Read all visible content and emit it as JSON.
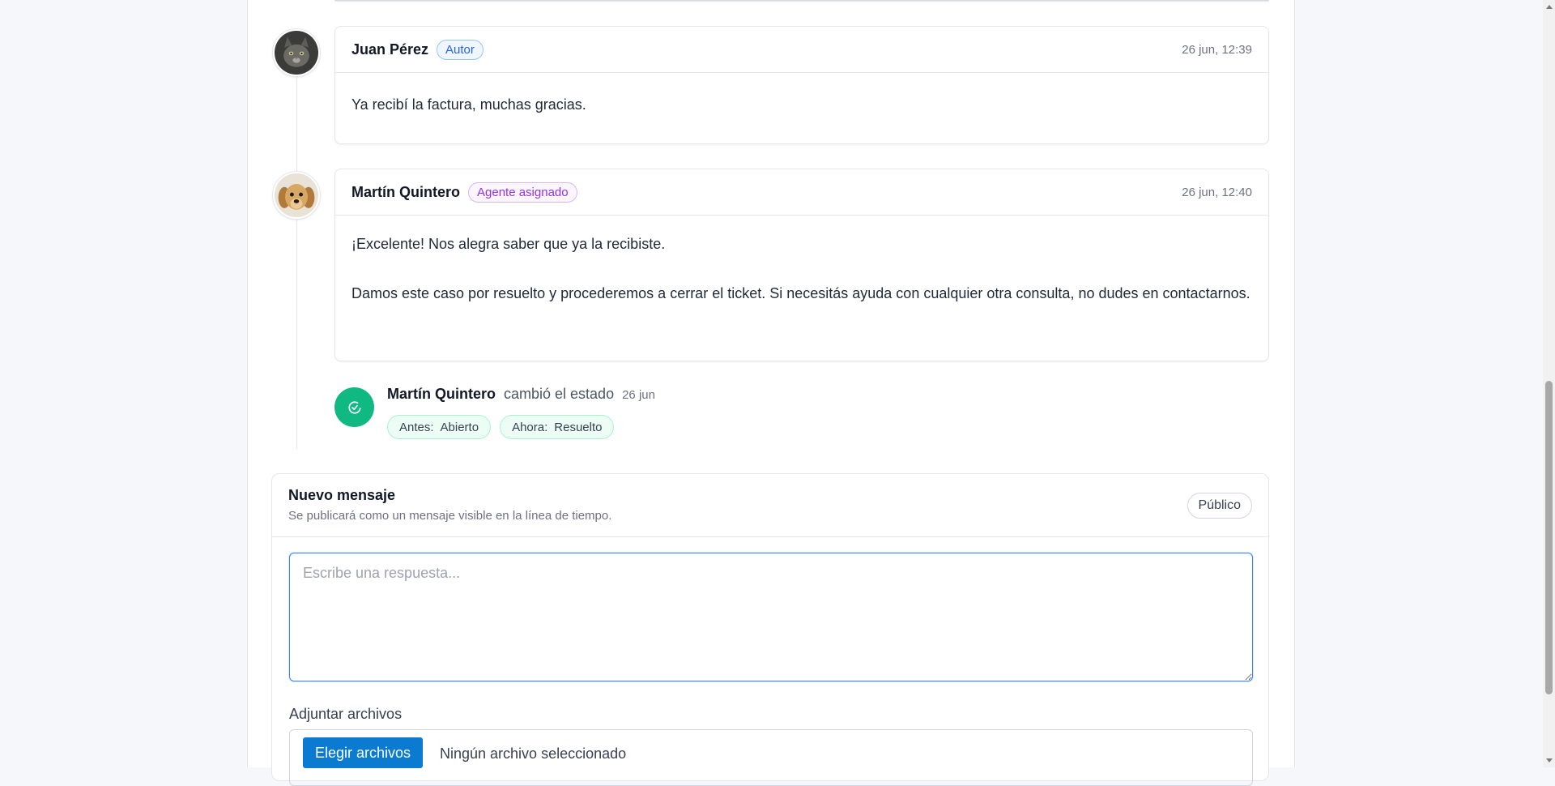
{
  "messages": [
    {
      "author": "Juan Pérez",
      "badge": "Autor",
      "time": "26 jun, 12:39",
      "paragraphs": [
        "Ya recibí la factura, muchas gracias."
      ]
    },
    {
      "author": "Martín Quintero",
      "badge": "Agente asignado",
      "time": "26 jun, 12:40",
      "paragraphs": [
        "¡Excelente! Nos alegra saber que ya la recibiste.",
        "Damos este caso por resuelto y procederemos a cerrar el ticket. Si necesitás ayuda con cualquier otra consulta, no dudes en contactarnos."
      ]
    }
  ],
  "status_event": {
    "actor": "Martín Quintero",
    "action": "cambió el estado",
    "date": "26 jun",
    "before_label": "Antes:",
    "before_value": "Abierto",
    "after_label": "Ahora:",
    "after_value": "Resuelto",
    "icon": "check-circle-icon",
    "color": "#10b981"
  },
  "composer": {
    "title": "Nuevo mensaje",
    "subtitle": "Se publicará como un mensaje visible en la línea de tiempo.",
    "visibility": "Público",
    "placeholder": "Escribe una respuesta...",
    "attach_label": "Adjuntar archivos",
    "file_button": "Elegir archivos",
    "file_status": "Ningún archivo seleccionado"
  },
  "colors": {
    "author_badge": "#2563eb",
    "agent_badge": "#9333ea",
    "file_button": "#0b7bd1"
  }
}
